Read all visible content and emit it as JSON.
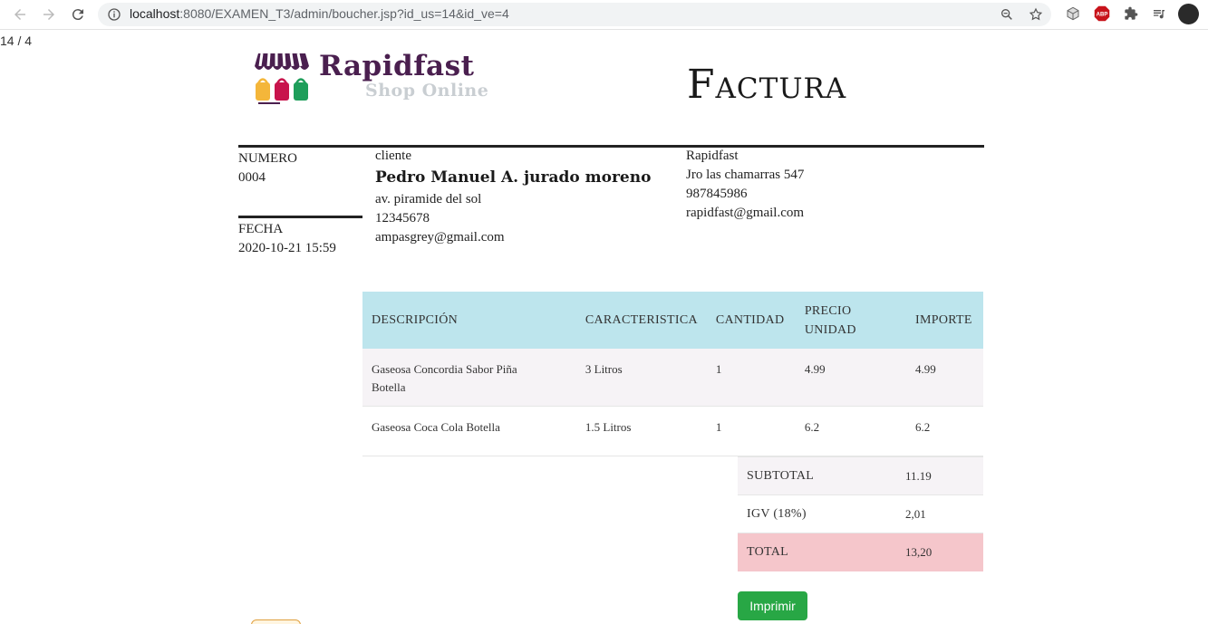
{
  "browser": {
    "url_host": "localhost",
    "url_path": ":8080/EXAMEN_T3/admin/boucher.jsp?id_us=14&id_ve=4",
    "extensions": [
      "3d-box-icon",
      "adblock-icon",
      "puzzle-icon",
      "media-queue-icon"
    ],
    "abp_label": "ABP"
  },
  "page_counter": "14 / 4",
  "logo": {
    "brand": "Rapidfast",
    "tagline": "Shop Online"
  },
  "doc_title": "Factura",
  "invoice": {
    "numero_label": "NUMERO",
    "numero": "0004",
    "fecha_label": "FECHA",
    "fecha": "2020-10-21 15:59"
  },
  "cliente": {
    "label": "cliente",
    "name": "Pedro Manuel A. jurado moreno",
    "address": "av. piramide del sol",
    "phone": "12345678",
    "email": "ampasgrey@gmail.com"
  },
  "empresa": {
    "name": "Rapidfast",
    "address": "Jro las chamarras 547",
    "phone": "987845986",
    "email": "rapidfast@gmail.com"
  },
  "items": {
    "headers": {
      "descripcion": "DESCRIPCIÓN",
      "caracteristica": "CARACTERISTICA",
      "cantidad": "CANTIDAD",
      "precio_1": "PRECIO",
      "precio_2": "UNIDAD",
      "importe": "IMPORTE"
    },
    "rows": [
      {
        "descripcion_1": "Gaseosa Concordia Sabor Piña",
        "descripcion_2": "Botella",
        "caracteristica": "3 Litros",
        "cantidad": "1",
        "precio": "4.99",
        "importe": "4.99"
      },
      {
        "descripcion_1": "Gaseosa Coca Cola Botella",
        "descripcion_2": "",
        "caracteristica": "1.5 Litros",
        "cantidad": "1",
        "precio": "6.2",
        "importe": "6.2"
      }
    ]
  },
  "totals": {
    "subtotal_label": "SUBTOTAL",
    "subtotal": "11.19",
    "igv_label": "IGV (18%)",
    "igv": "2,01",
    "total_label": "TOTAL",
    "total": "13,20"
  },
  "print_button": "Imprimir",
  "colors": {
    "header_bg": "#bde5ed",
    "total_bg": "#f5c6cb",
    "button": "#28a745",
    "brand": "#4a1f4f"
  }
}
